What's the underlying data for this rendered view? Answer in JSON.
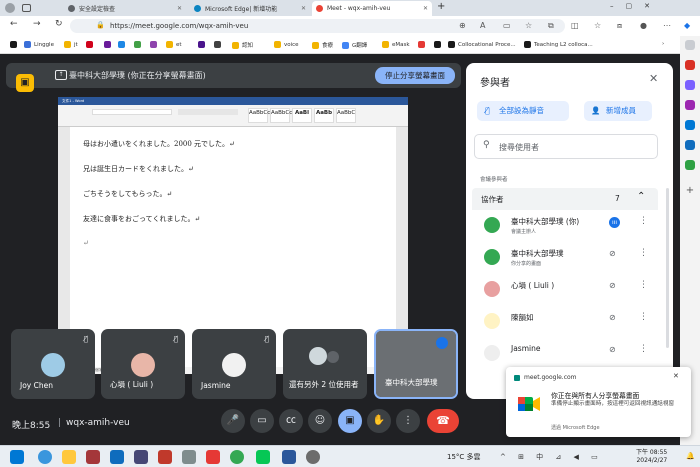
{
  "browser": {
    "tabs": [
      {
        "label": "安全設定檢查",
        "color": "#5f6368"
      },
      {
        "label": "Microsoft Edge| 新增功能",
        "color": "#0a84c1"
      },
      {
        "label": "Meet - wqx-amih-veu",
        "color": "#ea4335"
      }
    ],
    "url": "https://meet.google.com/wqx-amih-veu",
    "bookmarks": [
      {
        "label": "",
        "color": "#1a1a1a"
      },
      {
        "label": "Linggle",
        "color": "#3b6fd8"
      },
      {
        "label": "jt",
        "color": "#f2b400"
      },
      {
        "label": "",
        "color": "#d0021b"
      },
      {
        "label": "",
        "color": "#6a1b9a"
      },
      {
        "label": "",
        "color": "#1e88e5"
      },
      {
        "label": "",
        "color": "#43a047"
      },
      {
        "label": "",
        "color": "#8e44ad"
      },
      {
        "label": "et",
        "color": "#f2b400"
      },
      {
        "label": "",
        "color": "#4a148c"
      },
      {
        "label": "",
        "color": "#424242"
      },
      {
        "label": "認知",
        "color": "#f2b400"
      },
      {
        "label": "voice",
        "color": "#f2b400"
      },
      {
        "label": "食療",
        "color": "#f2b400"
      },
      {
        "label": "G翻譯",
        "color": "#4285f4"
      },
      {
        "label": "eMask",
        "color": "#f2b400"
      },
      {
        "label": "",
        "color": "#e53935"
      },
      {
        "label": "",
        "color": "#1a1a1a"
      },
      {
        "label": "Collocational Proce...",
        "color": "#1a1a1a"
      },
      {
        "label": "Teaching L2 colloca...",
        "color": "#1a1a1a"
      }
    ]
  },
  "meet": {
    "banner_text": "臺中科大部學璞 (你正在分享螢幕畫面)",
    "stop_share_label": "停止分享螢幕畫面",
    "clock": "晚上8:55",
    "meeting_code": "wqx-amih-veu",
    "tiles": [
      {
        "name": "Joy Chen"
      },
      {
        "name": "心塤 ( Liuli )"
      },
      {
        "name": "Jasmine"
      },
      {
        "name": "還有另外 2 位使用者"
      },
      {
        "name": "臺中科大部學璞"
      }
    ]
  },
  "doc": {
    "title_bar": "文件1 - Word",
    "styles": [
      "AaBbCcDc",
      "AaBbCcDc",
      "AaBl",
      "AaBb",
      "AaBbC"
    ],
    "lines": [
      "母はお小遣いをくれました。2000 元でした。↵",
      "兄は誕生日カードをくれました。↵",
      "ごちそうをしてもらった。↵",
      "友達に食事をおごってくれました。↵",
      "↵"
    ],
    "status": "第 1 頁，共 1 頁   79 個字   中文 (台灣)"
  },
  "panel": {
    "title": "參與者",
    "mute_all_label": "全部設為靜音",
    "add_label": "新增成員",
    "search_placeholder": "搜尋使用者",
    "section_label": "會議參與者",
    "group_label": "協作者",
    "group_count": "7",
    "people": [
      {
        "name": "臺中科大部學璞 (你)",
        "sub": "會議主辦人",
        "color": "#34a853"
      },
      {
        "name": "臺中科大部學璞",
        "sub": "你分享的畫面",
        "color": "#34a853"
      },
      {
        "name": "心塤 ( Liuli )",
        "sub": "",
        "color": "#e8a0a0"
      },
      {
        "name": "陳韻如",
        "sub": "",
        "color": "#fff3c4"
      },
      {
        "name": "Jasmine",
        "sub": "",
        "color": "#eeeeee"
      }
    ]
  },
  "toast": {
    "site": "meet.google.com",
    "title": "你正在與所有人分享螢幕畫面",
    "body": "準備停止顯示畫面時，按這裡可返回視訊通話視窗",
    "footer": "透過 Microsoft Edge"
  },
  "taskbar": {
    "weather": "15°C 多雲",
    "time": "下午 08:55",
    "date": "2024/2/27"
  }
}
